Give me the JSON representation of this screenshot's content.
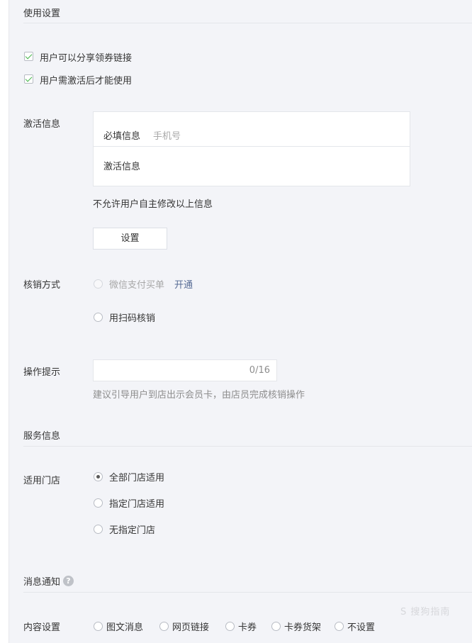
{
  "usage": {
    "title": "使用设置",
    "checkbox_share": "用户可以分享领券链接",
    "checkbox_activate": "用户需激活后才能使用"
  },
  "activation": {
    "label": "激活信息",
    "required_label": "必填信息",
    "required_value": "手机号",
    "activate_label": "激活信息",
    "no_modify": "不允许用户自主修改以上信息",
    "settings_button": "设置"
  },
  "verify": {
    "label": "核销方式",
    "wechat_pay": "微信支付买单",
    "open_link": "开通",
    "scan_code": "用扫码核销"
  },
  "tips": {
    "label": "操作提示",
    "counter": "0/16",
    "hint": "建议引导用户到店出示会员卡，由店员完成核销操作"
  },
  "service": {
    "title": "服务信息",
    "stores_label": "适用门店",
    "stores_options": [
      "全部门店适用",
      "指定门店适用",
      "无指定门店"
    ],
    "selected_store": "全部门店适用"
  },
  "message": {
    "title": "消息通知",
    "help_icon": "question-icon",
    "content_label": "内容设置",
    "content_options": [
      "图文消息",
      "网页链接",
      "卡券",
      "卡券货架",
      "不设置"
    ]
  },
  "watermark": "S 搜狗指南",
  "colors": {
    "background": "#f3f4f8",
    "check_green": "#44b549",
    "link_blue": "#576b95"
  }
}
